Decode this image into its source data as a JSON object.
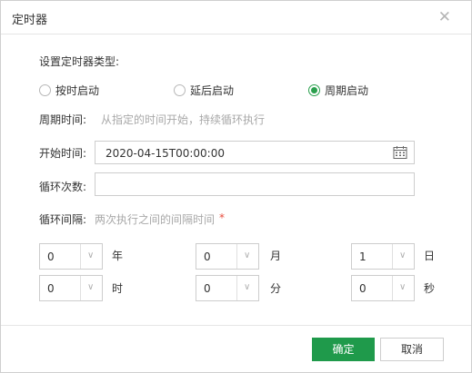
{
  "dialog": {
    "title": "定时器",
    "close_icon": "close-icon"
  },
  "type_section": {
    "label": "设置定时器类型:",
    "options": [
      {
        "label": "按时启动",
        "selected": false
      },
      {
        "label": "延后启动",
        "selected": false
      },
      {
        "label": "周期启动",
        "selected": true
      }
    ]
  },
  "period_time": {
    "label": "周期时间:",
    "hint": "从指定的时间开始，持续循环执行"
  },
  "start_time": {
    "label": "开始时间:",
    "value": "2020-04-15T00:00:00",
    "icon": "calendar-icon"
  },
  "loop_count": {
    "label": "循环次数:",
    "value": ""
  },
  "interval": {
    "label": "循环间隔:",
    "hint": "两次执行之间的间隔时间",
    "required_mark": "*",
    "fields": [
      {
        "value": "0",
        "unit": "年"
      },
      {
        "value": "0",
        "unit": "月"
      },
      {
        "value": "1",
        "unit": "日"
      },
      {
        "value": "0",
        "unit": "时"
      },
      {
        "value": "0",
        "unit": "分"
      },
      {
        "value": "0",
        "unit": "秒"
      }
    ],
    "dropdown_icon": "chevron-down-icon"
  },
  "footer": {
    "ok_label": "确定",
    "cancel_label": "取消"
  },
  "colors": {
    "accent": "#1f9a4b",
    "hint": "#a8a8a8",
    "required": "#e84c3d"
  }
}
